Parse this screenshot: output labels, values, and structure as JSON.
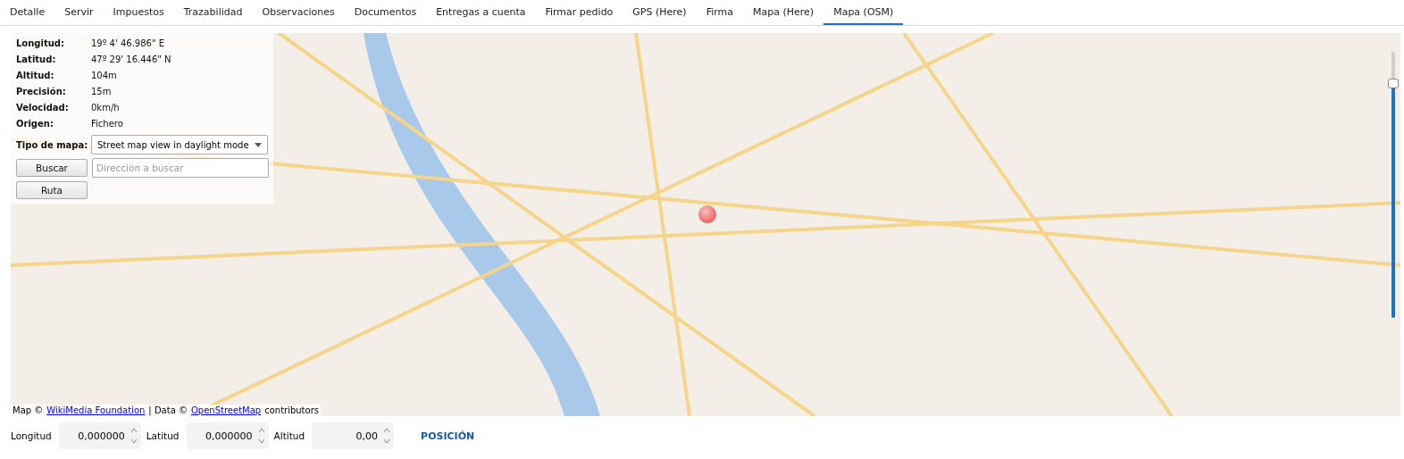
{
  "tabs": [
    {
      "label": "Detalle",
      "selected": false
    },
    {
      "label": "Servir",
      "selected": false
    },
    {
      "label": "Impuestos",
      "selected": false
    },
    {
      "label": "Trazabilidad",
      "selected": false
    },
    {
      "label": "Observaciones",
      "selected": false
    },
    {
      "label": "Documentos",
      "selected": false
    },
    {
      "label": "Entregas a cuenta",
      "selected": false
    },
    {
      "label": "Firmar pedido",
      "selected": false
    },
    {
      "label": "GPS (Here)",
      "selected": false
    },
    {
      "label": "Firma",
      "selected": false
    },
    {
      "label": "Mapa (Here)",
      "selected": false
    },
    {
      "label": "Mapa (OSM)",
      "selected": true
    }
  ],
  "map": {
    "info": [
      {
        "label": "Longitud:",
        "value": "19º 4' 46.986\" E"
      },
      {
        "label": "Latitud:",
        "value": "47º 29' 16.446\" N"
      },
      {
        "label": "Altitud:",
        "value": "104m"
      },
      {
        "label": "Precisión:",
        "value": "15m"
      },
      {
        "label": "Velocidad:",
        "value": "0km/h"
      },
      {
        "label": "Origen:",
        "value": "Fichero"
      }
    ],
    "map_type": {
      "label": "Tipo de mapa:",
      "value": "Street map view in daylight mode"
    },
    "search_button": "Buscar",
    "search": {
      "placeholder": "Dirección a buscar"
    },
    "route_button": "Ruta",
    "attribution": [
      {
        "kind": "text",
        "text": "Map ©"
      },
      {
        "kind": "link",
        "text": "WikiMedia Foundation"
      },
      {
        "kind": "text",
        "text": "| Data ©"
      },
      {
        "kind": "link",
        "text": "OpenStreetMap"
      },
      {
        "kind": "text",
        "text": "contributors"
      }
    ],
    "zoom": {
      "level": 0.88
    }
  },
  "coordinates": [
    {
      "label": "Longitud",
      "value": "0,000000"
    },
    {
      "label": "Latitud",
      "value": "0,000000"
    },
    {
      "label": "Altitud",
      "value": "0,00"
    }
  ],
  "position_button": "POSICIÓN"
}
